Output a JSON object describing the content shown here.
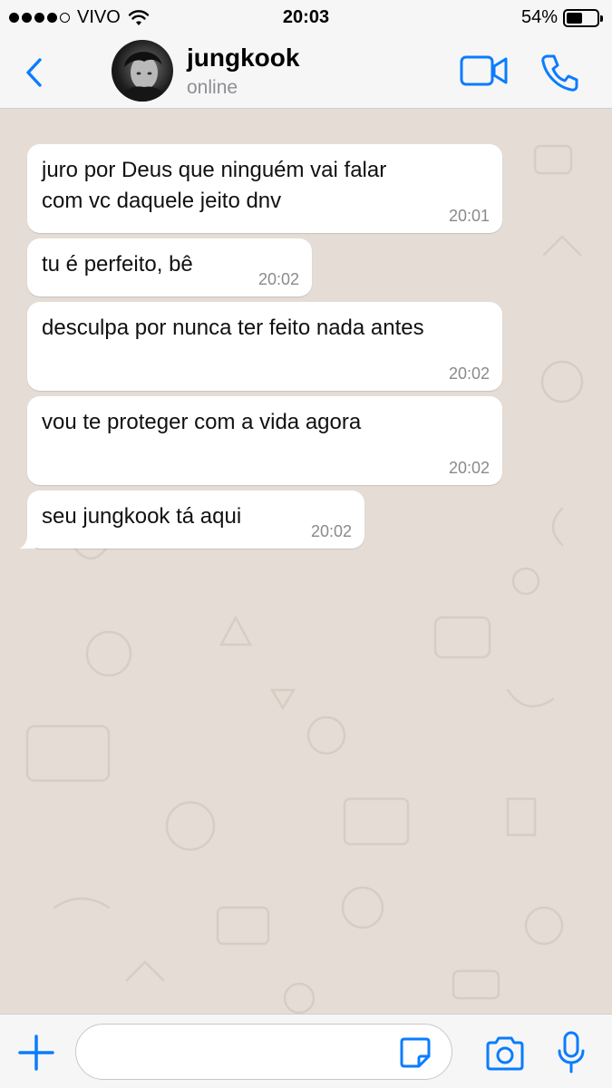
{
  "status_bar": {
    "carrier": "VIVO",
    "time": "20:03",
    "battery_percent": "54%",
    "battery_level": 0.54,
    "signal_bars_filled": 4,
    "signal_bars_total": 5
  },
  "header": {
    "contact_name": "jungkook",
    "contact_status": "online",
    "back_icon": "chevron-left-icon",
    "video_icon": "video-camera-icon",
    "call_icon": "phone-icon"
  },
  "messages": [
    {
      "text": "juro por Deus que ninguém vai falar com vc daquele jeito dnv",
      "time": "20:01"
    },
    {
      "text": "tu é perfeito, bê",
      "time": "20:02"
    },
    {
      "text": "desculpa por nunca ter feito nada antes",
      "time": "20:02"
    },
    {
      "text": "vou te proteger com a vida agora",
      "time": "20:02"
    },
    {
      "text": "seu jungkook tá aqui",
      "time": "20:02"
    }
  ],
  "input_bar": {
    "placeholder": "",
    "icons": [
      "plus-icon",
      "sticker-icon",
      "camera-icon",
      "microphone-icon"
    ]
  },
  "colors": {
    "accent": "#0a7cff",
    "chat_background": "#e5ddd5",
    "bubble": "#ffffff",
    "timestamp": "#8a8a8a"
  }
}
